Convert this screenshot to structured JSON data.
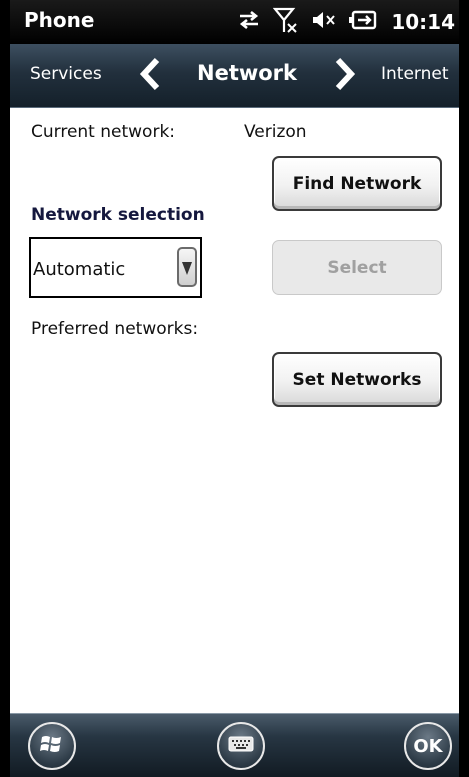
{
  "status_bar": {
    "app_title": "Phone",
    "time": "10:14",
    "icons": [
      "data-transfer-icon",
      "no-signal-icon",
      "speaker-muted-icon",
      "battery-charging-icon"
    ]
  },
  "nav": {
    "prev_label": "Services",
    "title": "Network",
    "next_label": "Internet"
  },
  "content": {
    "current_network_label": "Current network:",
    "current_network_value": "Verizon",
    "find_network_label": "Find Network",
    "network_selection_heading": "Network selection",
    "network_selection_value": "Automatic",
    "select_label": "Select",
    "preferred_networks_label": "Preferred networks:",
    "set_networks_label": "Set Networks"
  },
  "bottom_bar": {
    "ok_label": "OK"
  },
  "colors": {
    "heading": "#15183e",
    "disabled_text": "#a0a0a0"
  }
}
